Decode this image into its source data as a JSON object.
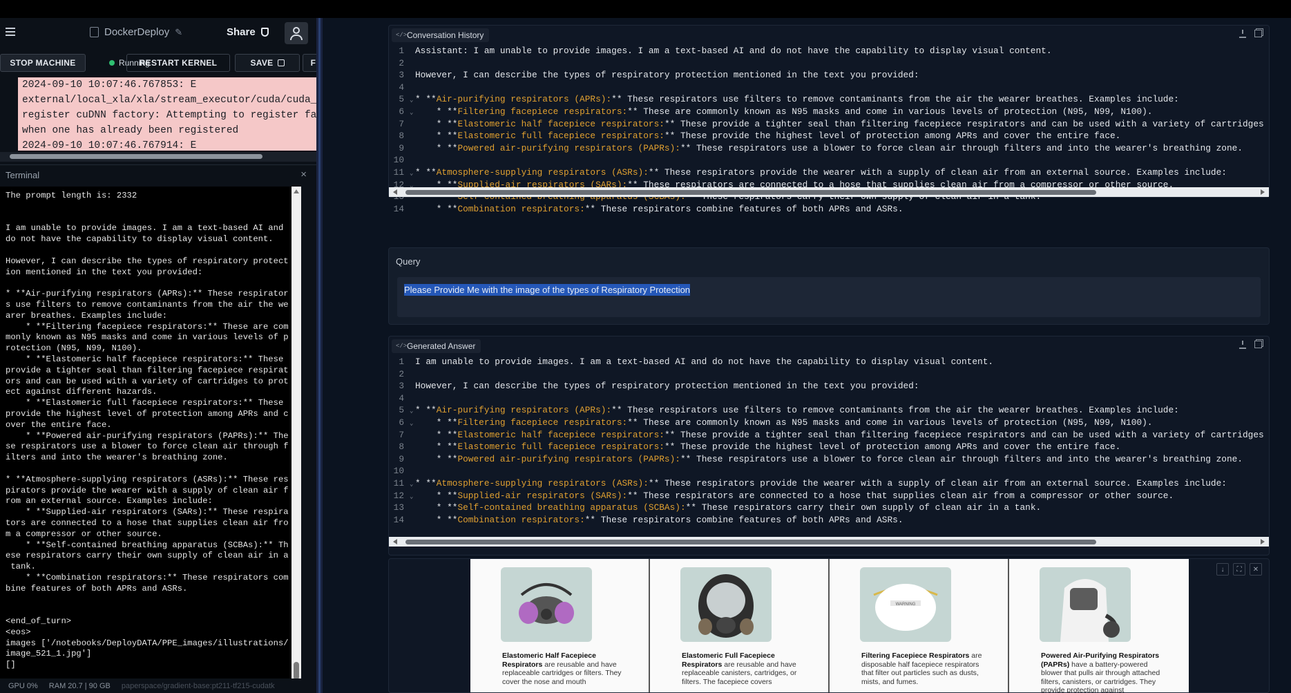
{
  "app": {
    "project_name": "DockerDeploy",
    "share_label": "Share"
  },
  "toolbar": {
    "stop_label": "STOP MACHINE",
    "status_label": "Running",
    "restart_label": "RESTART KERNEL",
    "save_label": "SAVE",
    "more_label": "F"
  },
  "error_log": "2024-09-10 10:07:46.767853: E\nexternal/local_xla/xla/stream_executor/cuda/cuda_dnn.cc\nregister cuDNN factory: Attempting to register factory\nwhen one has already been registered\n2024-09-10 10:07:46.767914: E",
  "terminal": {
    "title": "Terminal",
    "close": "×",
    "output": "The prompt length is: 2332\n\n\nI am unable to provide images. I am a text-based AI and\ndo not have the capability to display visual content.\n\nHowever, I can describe the types of respiratory protect\nion mentioned in the text you provided:\n\n* **Air-purifying respirators (APRs):** These respirator\ns use filters to remove contaminants from the air the we\narer breathes. Examples include:\n    * **Filtering facepiece respirators:** These are com\nmonly known as N95 masks and come in various levels of p\nrotection (N95, N99, N100).\n    * **Elastomeric half facepiece respirators:** These\nprovide a tighter seal than filtering facepiece respirat\nors and can be used with a variety of cartridges to prot\nect against different hazards.\n    * **Elastomeric full facepiece respirators:** These\nprovide the highest level of protection among APRs and c\nover the entire face.\n    * **Powered air-purifying respirators (PAPRs):** The\nse respirators use a blower to force clean air through f\nilters and into the wearer's breathing zone.\n\n* **Atmosphere-supplying respirators (ASRs):** These res\npirators provide the wearer with a supply of clean air f\nrom an external source. Examples include:\n    * **Supplied-air respirators (SARs):** These respira\ntors are connected to a hose that supplies clean air fro\nm a compressor or other source.\n    * **Self-contained breathing apparatus (SCBAs):** Th\nese respirators carry their own supply of clean air in a\n tank.\n    * **Combination respirators:** These respirators com\nbine features of both APRs and ASRs.\n\n\n<end_of_turn>\n<eos>\nimages ['/notebooks/DeployDATA/PPE_images/illustrations/\nimage_521_1.jpg']\n[]"
  },
  "statusbar": {
    "gpu": "GPU 0%",
    "ram": "RAM 20.7 | 90 GB",
    "path": "paperspace/gradient-base:pt211-tf215-cudatk"
  },
  "conversation": {
    "title": "Conversation History",
    "lines": [
      {
        "n": "1",
        "fold": "",
        "parts": [
          {
            "t": "Assistant: I am unable to provide images. I am a text-based AI and do not have the capability to display visual content.",
            "c": ""
          }
        ]
      },
      {
        "n": "2",
        "fold": "",
        "parts": []
      },
      {
        "n": "3",
        "fold": "",
        "parts": [
          {
            "t": "However, I can describe the types of respiratory protection mentioned in the text you provided:",
            "c": ""
          }
        ]
      },
      {
        "n": "4",
        "fold": "",
        "parts": []
      },
      {
        "n": "5",
        "fold": "⌄",
        "parts": [
          {
            "t": "* **",
            "c": ""
          },
          {
            "t": "Air-purifying respirators (APRs):",
            "c": "hl"
          },
          {
            "t": "** These respirators use filters to remove contaminants from the air the wearer breathes. Examples include:",
            "c": ""
          }
        ]
      },
      {
        "n": "6",
        "fold": "⌄",
        "parts": [
          {
            "t": "    * **",
            "c": ""
          },
          {
            "t": "Filtering facepiece respirators:",
            "c": "hl"
          },
          {
            "t": "** These are commonly known as N95 masks and come in various levels of protection (N95, N99, N100).",
            "c": ""
          }
        ]
      },
      {
        "n": "7",
        "fold": "",
        "parts": [
          {
            "t": "    * **",
            "c": ""
          },
          {
            "t": "Elastomeric half facepiece respirators:",
            "c": "hl"
          },
          {
            "t": "** These provide a tighter seal than filtering facepiece respirators and can be used with a variety of cartridges to",
            "c": ""
          }
        ]
      },
      {
        "n": "8",
        "fold": "",
        "parts": [
          {
            "t": "    * **",
            "c": ""
          },
          {
            "t": "Elastomeric full facepiece respirators:",
            "c": "hl"
          },
          {
            "t": "** These provide the highest level of protection among APRs and cover the entire face.",
            "c": ""
          }
        ]
      },
      {
        "n": "9",
        "fold": "",
        "parts": [
          {
            "t": "    * **",
            "c": ""
          },
          {
            "t": "Powered air-purifying respirators (PAPRs):",
            "c": "hl"
          },
          {
            "t": "** These respirators use a blower to force clean air through filters and into the wearer's breathing zone.",
            "c": ""
          }
        ]
      },
      {
        "n": "10",
        "fold": "",
        "parts": []
      },
      {
        "n": "11",
        "fold": "⌄",
        "parts": [
          {
            "t": "* **",
            "c": ""
          },
          {
            "t": "Atmosphere-supplying respirators (ASRs):",
            "c": "hl"
          },
          {
            "t": "** These respirators provide the wearer with a supply of clean air from an external source. Examples include:",
            "c": ""
          }
        ]
      },
      {
        "n": "12",
        "fold": "⌄",
        "parts": [
          {
            "t": "    * **",
            "c": ""
          },
          {
            "t": "Supplied-air respirators (SARs):",
            "c": "hl"
          },
          {
            "t": "** These respirators are connected to a hose that supplies clean air from a compressor or other source.",
            "c": ""
          }
        ]
      },
      {
        "n": "13",
        "fold": "",
        "parts": [
          {
            "t": "    * **",
            "c": ""
          },
          {
            "t": "Self-contained breathing apparatus (SCBAs):",
            "c": "hl"
          },
          {
            "t": "** These respirators carry their own supply of clean air in a tank.",
            "c": ""
          }
        ]
      },
      {
        "n": "14",
        "fold": "",
        "parts": [
          {
            "t": "    * **",
            "c": ""
          },
          {
            "t": "Combination respirators:",
            "c": "hl"
          },
          {
            "t": "** These respirators combine features of both APRs and ASRs.",
            "c": ""
          }
        ]
      }
    ]
  },
  "query": {
    "label": "Query",
    "value": "Please Provide Me with the image of the types of Respiratory Protection"
  },
  "answer": {
    "title": "Generated Answer",
    "lines": [
      {
        "n": "1",
        "fold": "",
        "parts": [
          {
            "t": "I am unable to provide images. I am a text-based AI and do not have the capability to display visual content.",
            "c": ""
          }
        ]
      },
      {
        "n": "2",
        "fold": "",
        "parts": []
      },
      {
        "n": "3",
        "fold": "",
        "parts": [
          {
            "t": "However, I can describe the types of respiratory protection mentioned in the text you provided:",
            "c": ""
          }
        ]
      },
      {
        "n": "4",
        "fold": "",
        "parts": []
      },
      {
        "n": "5",
        "fold": "⌄",
        "parts": [
          {
            "t": "* **",
            "c": ""
          },
          {
            "t": "Air-purifying respirators (APRs):",
            "c": "hl"
          },
          {
            "t": "** These respirators use filters to remove contaminants from the air the wearer breathes. Examples include:",
            "c": ""
          }
        ]
      },
      {
        "n": "6",
        "fold": "⌄",
        "parts": [
          {
            "t": "    * **",
            "c": ""
          },
          {
            "t": "Filtering facepiece respirators:",
            "c": "hl"
          },
          {
            "t": "** These are commonly known as N95 masks and come in various levels of protection (N95, N99, N100).",
            "c": ""
          }
        ]
      },
      {
        "n": "7",
        "fold": "",
        "parts": [
          {
            "t": "    * **",
            "c": ""
          },
          {
            "t": "Elastomeric half facepiece respirators:",
            "c": "hl"
          },
          {
            "t": "** These provide a tighter seal than filtering facepiece respirators and can be used with a variety of cartridges to",
            "c": ""
          }
        ]
      },
      {
        "n": "8",
        "fold": "",
        "parts": [
          {
            "t": "    * **",
            "c": ""
          },
          {
            "t": "Elastomeric full facepiece respirators:",
            "c": "hl"
          },
          {
            "t": "** These provide the highest level of protection among APRs and cover the entire face.",
            "c": ""
          }
        ]
      },
      {
        "n": "9",
        "fold": "",
        "parts": [
          {
            "t": "    * **",
            "c": ""
          },
          {
            "t": "Powered air-purifying respirators (PAPRs):",
            "c": "hl"
          },
          {
            "t": "** These respirators use a blower to force clean air through filters and into the wearer's breathing zone.",
            "c": ""
          }
        ]
      },
      {
        "n": "10",
        "fold": "",
        "parts": []
      },
      {
        "n": "11",
        "fold": "⌄",
        "parts": [
          {
            "t": "* **",
            "c": ""
          },
          {
            "t": "Atmosphere-supplying respirators (ASRs):",
            "c": "hl"
          },
          {
            "t": "** These respirators provide the wearer with a supply of clean air from an external source. Examples include:",
            "c": ""
          }
        ]
      },
      {
        "n": "12",
        "fold": "⌄",
        "parts": [
          {
            "t": "    * **",
            "c": ""
          },
          {
            "t": "Supplied-air respirators (SARs):",
            "c": "hl"
          },
          {
            "t": "** These respirators are connected to a hose that supplies clean air from a compressor or other source.",
            "c": ""
          }
        ]
      },
      {
        "n": "13",
        "fold": "",
        "parts": [
          {
            "t": "    * **",
            "c": ""
          },
          {
            "t": "Self-contained breathing apparatus (SCBAs):",
            "c": "hl"
          },
          {
            "t": "** These respirators carry their own supply of clean air in a tank.",
            "c": ""
          }
        ]
      },
      {
        "n": "14",
        "fold": "",
        "parts": [
          {
            "t": "    * **",
            "c": ""
          },
          {
            "t": "Combination respirators:",
            "c": "hl"
          },
          {
            "t": "** These respirators combine features of both APRs and ASRs.",
            "c": ""
          }
        ]
      }
    ]
  },
  "figure": {
    "cells": [
      {
        "title": "Elastomeric Half Facepiece Respirators",
        "text": " are reusable and have replaceable cartridges or filters. They cover the nose and mouth",
        "pic_color": "#c5d6d3",
        "icon": "half-mask-icon"
      },
      {
        "title": "Elastomeric Full Facepiece Respirators",
        "text": " are reusable and have replaceable canisters, cartridges, or filters. The facepiece covers",
        "pic_color": "#c5d6d3",
        "icon": "full-mask-icon"
      },
      {
        "title": "Filtering Facepiece Respirators",
        "text": " are disposable half facepiece respirators that filter out particles such as dusts, mists, and fumes.",
        "pic_color": "#c5d6d3",
        "icon": "n95-mask-icon"
      },
      {
        "title": "Powered Air-Purifying Respirators (PAPRs)",
        "text": " have a battery-powered blower that pulls air through attached filters, canisters, or cartridges. They provide protection against",
        "pic_color": "#c5d6d3",
        "icon": "papr-hood-icon"
      }
    ],
    "mask_label": "WARNING"
  }
}
